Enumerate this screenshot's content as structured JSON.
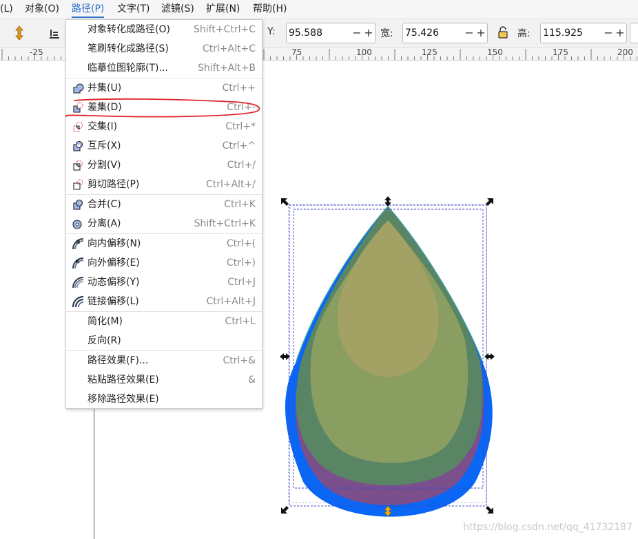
{
  "menubar": {
    "items": [
      {
        "label": "层(L)"
      },
      {
        "label": "对象(O)"
      },
      {
        "label": "路径(P)"
      },
      {
        "label": "文字(T)"
      },
      {
        "label": "滤镜(S)"
      },
      {
        "label": "扩展(N)"
      },
      {
        "label": "帮助(H)"
      }
    ]
  },
  "toolbar": {
    "y_label": "Y:",
    "y_value": "95.588",
    "w_label": "宽:",
    "w_value": "75.426",
    "h_label": "高:",
    "h_value": "115.925",
    "minus": "−",
    "plus": "+"
  },
  "ruler": {
    "labels": [
      "-25",
      "75",
      "100",
      "125",
      "150",
      "175",
      "200"
    ]
  },
  "path_menu": {
    "items": [
      {
        "label": "对象转化成路径(O)",
        "shortcut": "Shift+Ctrl+C"
      },
      {
        "label": "笔刷转化成路径(S)",
        "shortcut": "Ctrl+Alt+C"
      },
      {
        "label": "临摹位图轮廓(T)...",
        "shortcut": "Shift+Alt+B"
      },
      {
        "label": "并集(U)",
        "shortcut": "Ctrl++"
      },
      {
        "label": "差集(D)",
        "shortcut": "Ctrl+-"
      },
      {
        "label": "交集(I)",
        "shortcut": "Ctrl+*"
      },
      {
        "label": "互斥(X)",
        "shortcut": "Ctrl+^"
      },
      {
        "label": "分割(V)",
        "shortcut": "Ctrl+/"
      },
      {
        "label": "剪切路径(P)",
        "shortcut": "Ctrl+Alt+/"
      },
      {
        "label": "合并(C)",
        "shortcut": "Ctrl+K"
      },
      {
        "label": "分离(A)",
        "shortcut": "Shift+Ctrl+K"
      },
      {
        "label": "向内偏移(N)",
        "shortcut": "Ctrl+("
      },
      {
        "label": "向外偏移(E)",
        "shortcut": "Ctrl+)"
      },
      {
        "label": "动态偏移(Y)",
        "shortcut": "Ctrl+J"
      },
      {
        "label": "链接偏移(L)",
        "shortcut": "Ctrl+Alt+J"
      },
      {
        "label": "简化(M)",
        "shortcut": "Ctrl+L"
      },
      {
        "label": "反向(R)",
        "shortcut": ""
      },
      {
        "label": "路径效果(F)...",
        "shortcut": "Ctrl+&"
      },
      {
        "label": "粘贴路径效果(E)",
        "shortcut": "&"
      },
      {
        "label": "移除路径效果(E)",
        "shortcut": ""
      }
    ]
  },
  "colors": {
    "accent": "#2f6fd0",
    "blue_drop": "#0a66f5",
    "purple_drop": "#7a4f8c",
    "green_drop": "#5a8564",
    "olive_drop": "#8a9e62",
    "tan_drop": "#a3a163",
    "annotation": "#e0202a"
  },
  "watermark": "https://blog.csdn.net/qq_41732187"
}
